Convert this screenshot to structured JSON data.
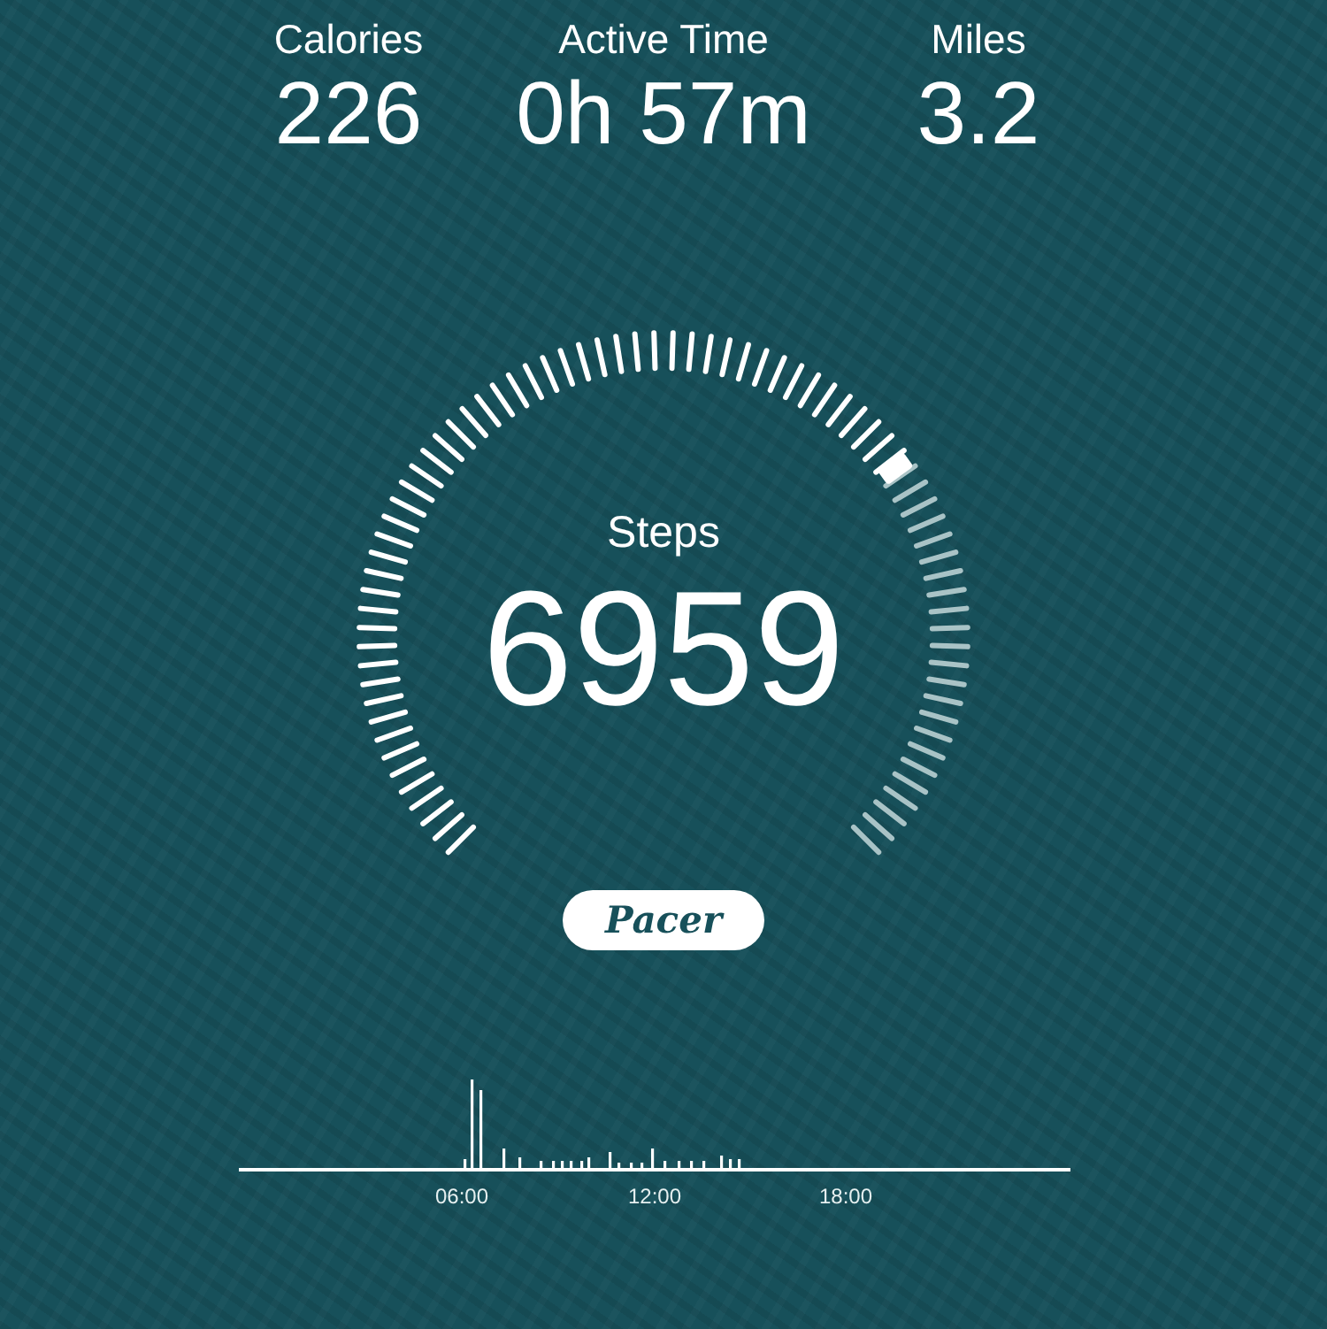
{
  "stats": [
    {
      "label": "Calories",
      "value": "226"
    },
    {
      "label": "Active Time",
      "value": "0h 57m"
    },
    {
      "label": "Miles",
      "value": "3.2"
    }
  ],
  "steps": {
    "label": "Steps",
    "value": "6959"
  },
  "logo": "Pacer",
  "activity": {
    "time_labels": [
      "06:00",
      "12:00",
      "18:00"
    ]
  }
}
